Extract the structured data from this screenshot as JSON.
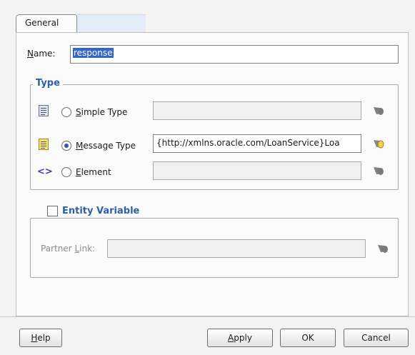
{
  "tabs": [
    {
      "label": "General"
    },
    {
      "label": ""
    }
  ],
  "name": {
    "label": "Name:",
    "value": "response"
  },
  "type_group": {
    "legend": "Type",
    "rows": [
      {
        "label": "Simple Type",
        "value": "",
        "selected": false,
        "icon": "document-icon"
      },
      {
        "label": "Message Type",
        "value": "{http://xmlns.oracle.com/LoanService}Loa",
        "selected": true,
        "icon": "document-yellow-icon"
      },
      {
        "label": "Element",
        "value": "",
        "selected": false,
        "icon": "element-icon"
      }
    ]
  },
  "entity": {
    "legend": "Entity Variable",
    "checked": false,
    "partner_link_label": "Partner Link:",
    "partner_link_value": ""
  },
  "buttons": {
    "help": "Help",
    "apply": "Apply",
    "ok": "OK",
    "cancel": "Cancel"
  },
  "colors": {
    "legend": "#2c5fa8",
    "selection": "#3366cc",
    "panel": "#fbfbfb"
  }
}
